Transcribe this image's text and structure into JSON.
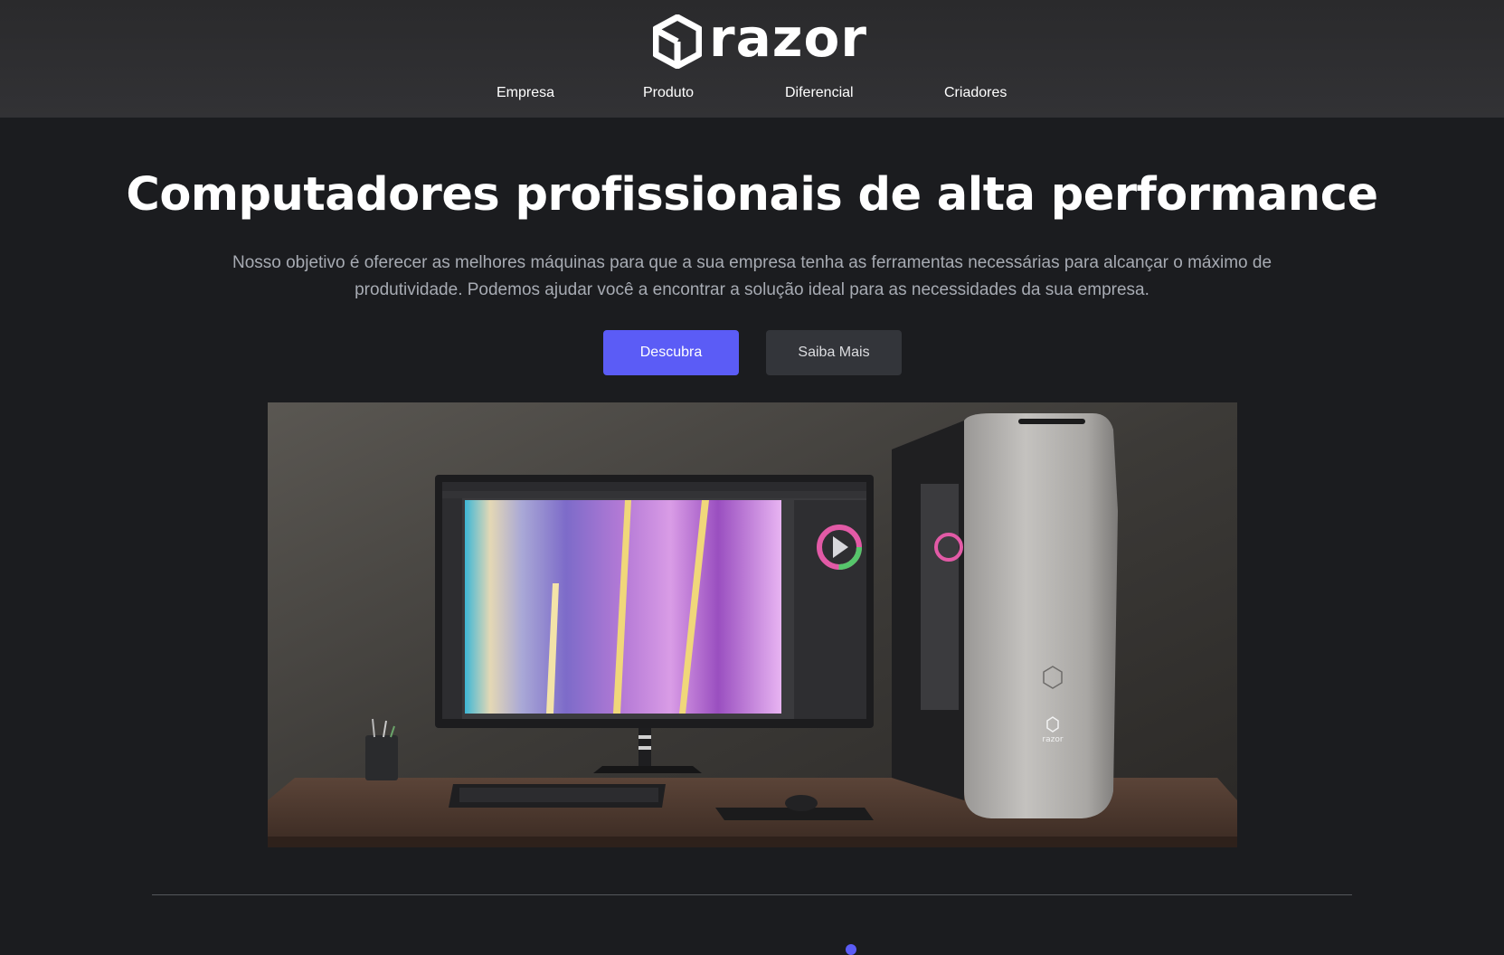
{
  "brand": {
    "name": "razor",
    "logo_icon": "hexagon-cube-icon"
  },
  "nav": {
    "items": [
      {
        "label": "Empresa"
      },
      {
        "label": "Produto"
      },
      {
        "label": "Diferencial"
      },
      {
        "label": "Criadores"
      }
    ]
  },
  "hero": {
    "title": "Computadores profissionais de alta performance",
    "description": "Nosso objetivo é oferecer as melhores máquinas para que a sua empresa tenha as ferramentas necessárias para alcançar o máximo de produtividade. Podemos ajudar você a encontrar a solução ideal para as necessidades da sua empresa.",
    "primary_button": "Descubra",
    "secondary_button": "Saiba Mais",
    "image_case_brand": "razor"
  },
  "colors": {
    "background": "#1b1c1f",
    "header": "#2f2f31",
    "accent": "#5b5cf6",
    "secondary_button": "#33353a",
    "muted_text": "#a7abb3"
  }
}
